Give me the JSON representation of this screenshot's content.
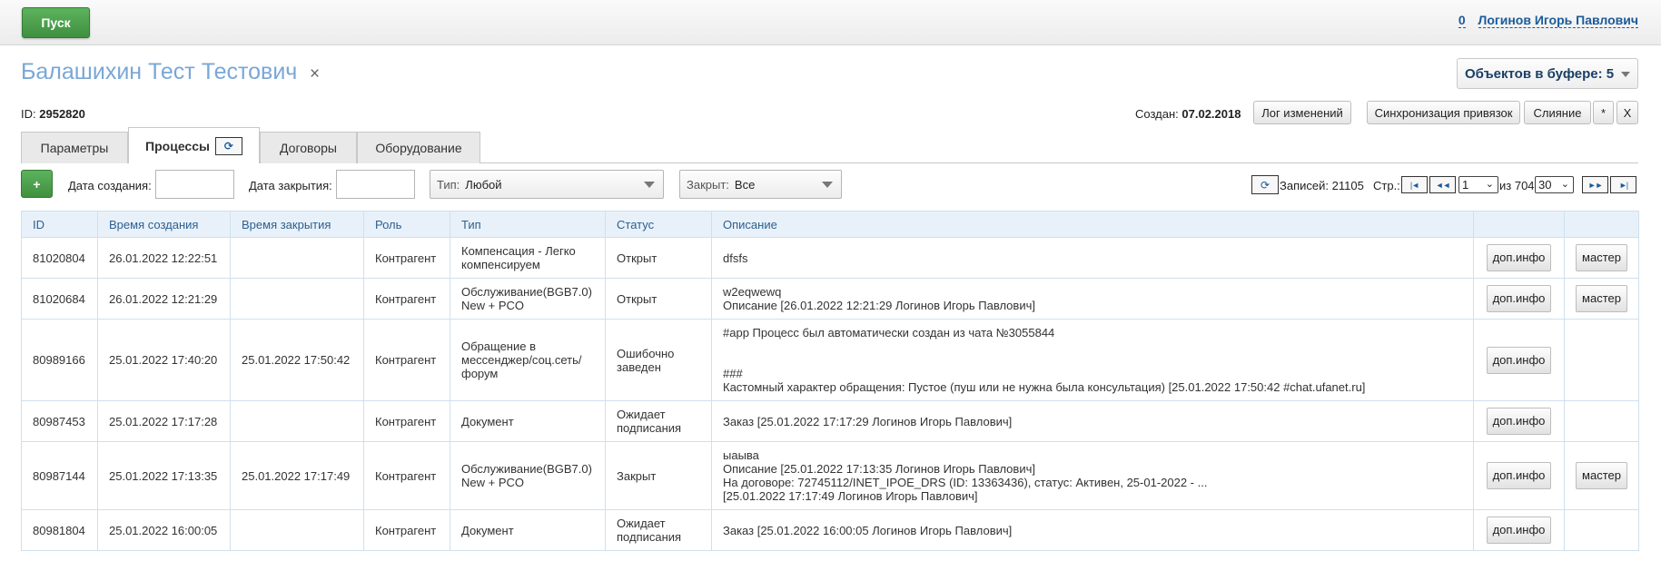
{
  "topbar": {
    "start_label": "Пуск",
    "count": "0",
    "user_name": "Логинов Игорь Павлович"
  },
  "client": {
    "title": "Балашихин Тест Тестович",
    "close_symbol": "×",
    "id_label": "ID:",
    "id_value": "2952820"
  },
  "buffer": {
    "label": "Объектов в буфере:",
    "count": "5"
  },
  "meta": {
    "created_label": "Создан:",
    "created_value": "07.02.2018"
  },
  "actions": {
    "log_label": "Лог изменений",
    "sync_label": "Синхронизация привязок",
    "merge_label": "Слияние",
    "star_label": "*",
    "x_label": "X"
  },
  "tabs": [
    {
      "label": "Параметры"
    },
    {
      "label": "Процессы"
    },
    {
      "label": "Договоры"
    },
    {
      "label": "Оборудование"
    }
  ],
  "filters": {
    "add_label": "+",
    "created_label": "Дата создания:",
    "closed_label": "Дата закрытия:",
    "type_label": "Тип:",
    "type_value": "Любой",
    "closed_sel_label": "Закрыт:",
    "closed_sel_value": "Все"
  },
  "pager": {
    "records_label": "Записей:",
    "records": "21105",
    "page_label": "Стр.:",
    "page": "1",
    "of_label": "из 704",
    "per_page": "30",
    "first": "|◄",
    "prev": "◄◄",
    "next": "►►",
    "last": "►|"
  },
  "table": {
    "headers": [
      "ID",
      "Время создания",
      "Время закрытия",
      "Роль",
      "Тип",
      "Статус",
      "Описание",
      "",
      ""
    ],
    "rows": [
      {
        "id": "81020804",
        "created": "26.01.2022 12:22:51",
        "closed": "",
        "role": "Контрагент",
        "type": "Компенсация - Легко компенсируем",
        "status": "Открыт",
        "desc": [
          "dfsfs"
        ],
        "info": "доп.инфо",
        "master": "мастер"
      },
      {
        "id": "81020684",
        "created": "26.01.2022 12:21:29",
        "closed": "",
        "role": "Контрагент",
        "type": "Обслуживание(BGB7.0) New + PCO",
        "status": "Открыт",
        "desc": [
          "w2eqwewq",
          "Описание [26.01.2022 12:21:29 Логинов Игорь Павлович]"
        ],
        "info": "доп.инфо",
        "master": "мастер"
      },
      {
        "id": "80989166",
        "created": "25.01.2022 17:40:20",
        "closed": "25.01.2022 17:50:42",
        "role": "Контрагент",
        "type": "Обращение в мессенджер/соц.сеть/форум",
        "status": "Ошибочно заведен",
        "desc": [
          "#app Процесс был автоматически создан из чата №3055844",
          "",
          "",
          "###",
          "Кастомный характер обращения: Пустое (пуш или не нужна была консультация) [25.01.2022 17:50:42 #chat.ufanet.ru]"
        ],
        "info": "доп.инфо",
        "master": ""
      },
      {
        "id": "80987453",
        "created": "25.01.2022 17:17:28",
        "closed": "",
        "role": "Контрагент",
        "type": "Документ",
        "status": "Ожидает подписания",
        "desc": [
          "Заказ [25.01.2022 17:17:29 Логинов Игорь Павлович]"
        ],
        "info": "доп.инфо",
        "master": ""
      },
      {
        "id": "80987144",
        "created": "25.01.2022 17:13:35",
        "closed": "25.01.2022 17:17:49",
        "role": "Контрагент",
        "type": "Обслуживание(BGB7.0) New + PCO",
        "status": "Закрыт",
        "desc": [
          "ыаыва",
          "Описание [25.01.2022 17:13:35 Логинов Игорь Павлович]",
          "На договоре: 72745112/INET_IPOE_DRS (ID: 13363436), статус: Активен, 25-01-2022 - ...",
          "[25.01.2022 17:17:49 Логинов Игорь Павлович]"
        ],
        "info": "доп.инфо",
        "master": "мастер"
      },
      {
        "id": "80981804",
        "created": "25.01.2022 16:00:05",
        "closed": "",
        "role": "Контрагент",
        "type": "Документ",
        "status": "Ожидает подписания",
        "desc": [
          "Заказ [25.01.2022 16:00:05 Логинов Игорь Павлович]"
        ],
        "info": "доп.инфо",
        "master": ""
      }
    ]
  }
}
